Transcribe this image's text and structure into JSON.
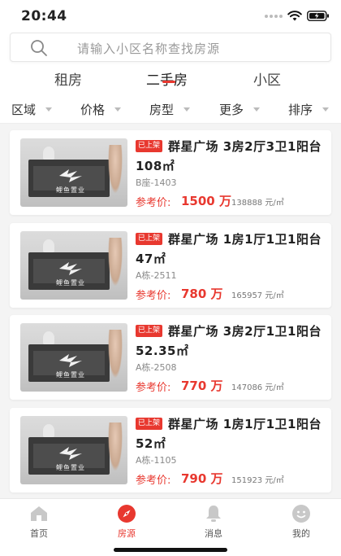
{
  "status_bar": {
    "time": "20:44"
  },
  "search": {
    "placeholder": "请输入小区名称查找房源"
  },
  "tabs": [
    {
      "label": "租房"
    },
    {
      "label": "二手房"
    },
    {
      "label": "小区"
    }
  ],
  "active_tab": "二手房",
  "filters": [
    {
      "label": "区域"
    },
    {
      "label": "价格"
    },
    {
      "label": "房型"
    },
    {
      "label": "更多"
    },
    {
      "label": "排序"
    }
  ],
  "listings": [
    {
      "badge": "已上架",
      "title": "群星广场 3房2厅3卫1阳台 108㎡",
      "subtitle": "B座-1403",
      "price_label": "参考价:",
      "price": "1500 万",
      "unit_price": "138888 元/㎡",
      "thumb_logo_text": "鲤鱼置业"
    },
    {
      "badge": "已上架",
      "title": "群星广场 1房1厅1卫1阳台 47㎡",
      "subtitle": "A栋-2511",
      "price_label": "参考价:",
      "price": "780 万",
      "unit_price": "165957 元/㎡",
      "thumb_logo_text": "鲤鱼置业"
    },
    {
      "badge": "已上架",
      "title": "群星广场 3房2厅1卫1阳台 52.35㎡",
      "subtitle": "A栋-2508",
      "price_label": "参考价:",
      "price": "770 万",
      "unit_price": "147086 元/㎡",
      "thumb_logo_text": "鲤鱼置业"
    },
    {
      "badge": "已上架",
      "title": "群星广场 1房1厅1卫1阳台 52㎡",
      "subtitle": "A栋-1105",
      "price_label": "参考价:",
      "price": "790 万",
      "unit_price": "151923 元/㎡",
      "thumb_logo_text": "鲤鱼置业"
    }
  ],
  "tabbar": [
    {
      "label": "首页",
      "icon": "home-icon"
    },
    {
      "label": "房源",
      "icon": "compass-icon"
    },
    {
      "label": "消息",
      "icon": "bell-icon"
    },
    {
      "label": "我的",
      "icon": "profile-icon"
    }
  ],
  "colors": {
    "accent": "#e8382f",
    "muted_icon": "#c8c8c8"
  }
}
